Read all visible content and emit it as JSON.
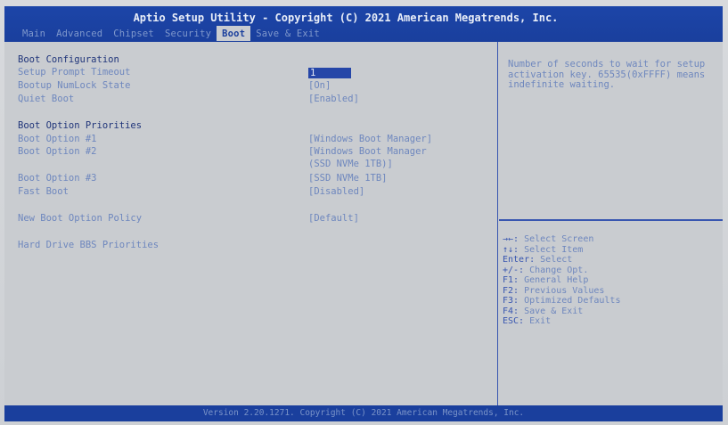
{
  "title": "Aptio Setup Utility - Copyright (C) 2021 American Megatrends, Inc.",
  "tabs": [
    "Main",
    "Advanced",
    "Chipset",
    "Security",
    "Boot",
    "Save & Exit"
  ],
  "active_tab": "Boot",
  "settings": [
    {
      "label": "Boot Configuration",
      "value": "",
      "header": true
    },
    {
      "label": "Setup Prompt Timeout",
      "value": "1",
      "selected": true
    },
    {
      "label": "Bootup NumLock State",
      "value": "[On]"
    },
    {
      "label": "Quiet Boot",
      "value": "[Enabled]"
    },
    {
      "label": "Boot Option Priorities",
      "value": "",
      "header": true
    },
    {
      "label": "Boot Option #1",
      "value": "[Windows Boot Manager]"
    },
    {
      "label": "Boot Option #2",
      "value": "[Windows Boot Manager"
    },
    {
      "label": "",
      "value": "(SSD NVMe 1TB)]"
    },
    {
      "label": "Boot Option #3",
      "value": "[SSD NVMe 1TB]"
    },
    {
      "label": "Fast Boot",
      "value": "[Disabled]"
    },
    {
      "label": "New Boot Option Policy",
      "value": "[Default]"
    },
    {
      "label": "Hard Drive BBS Priorities",
      "value": ""
    }
  ],
  "help_text": "Number of seconds to wait for setup activation key. 65535(0xFFFF) means indefinite waiting.",
  "keys": [
    {
      "key": "→←:",
      "desc": "Select Screen"
    },
    {
      "key": "↑↓:",
      "desc": "Select Item"
    },
    {
      "key": "Enter:",
      "desc": "Select"
    },
    {
      "key": "+/-:",
      "desc": "Change Opt."
    },
    {
      "key": "F1:",
      "desc": "General Help"
    },
    {
      "key": "F2:",
      "desc": "Previous Values"
    },
    {
      "key": "F3:",
      "desc": "Optimized Defaults"
    },
    {
      "key": "F4:",
      "desc": "Save & Exit"
    },
    {
      "key": "ESC:",
      "desc": "Exit"
    }
  ],
  "footer": "Version 2.20.1271. Copyright (C) 2021 American Megatrends, Inc."
}
